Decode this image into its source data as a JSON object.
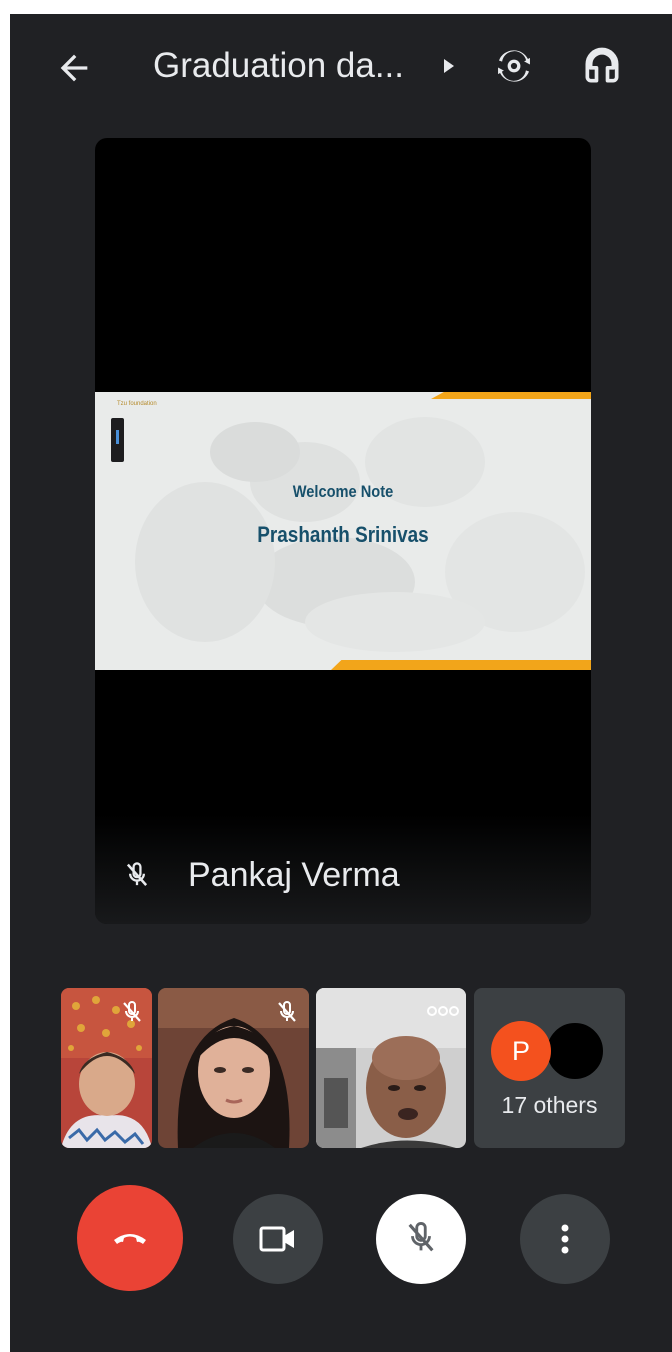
{
  "header": {
    "title": "Graduation da...",
    "back_icon": "arrow-left-icon",
    "caret_icon": "play-right-icon",
    "switch_camera_icon": "switch-camera-icon",
    "audio_icon": "headphones-icon"
  },
  "main_video": {
    "participant_name": "Pankaj Verma",
    "mic_icon": "mic-off-icon",
    "slide": {
      "logo_text": "Tzu foundation",
      "heading": "Welcome Note",
      "speaker": "Prashanth Srinivas"
    }
  },
  "participants": {
    "tiles": [
      {
        "type": "video",
        "muted": true,
        "icon": "mic-off-icon"
      },
      {
        "type": "video",
        "muted": true,
        "icon": "mic-off-icon"
      },
      {
        "type": "video",
        "muted": false,
        "icon": "more-horizontal-icon"
      }
    ],
    "others": {
      "avatar_letter": "P",
      "label": "17 others"
    }
  },
  "controls": {
    "end_call_icon": "phone-hangup-icon",
    "camera_icon": "videocam-icon",
    "mic_icon": "mic-off-icon",
    "more_icon": "more-vertical-icon"
  },
  "colors": {
    "background": "#202124",
    "end_call": "#ea4335",
    "avatar_p": "#f4511e",
    "slide_accent": "#f2a51a",
    "slide_text": "#17506b"
  }
}
